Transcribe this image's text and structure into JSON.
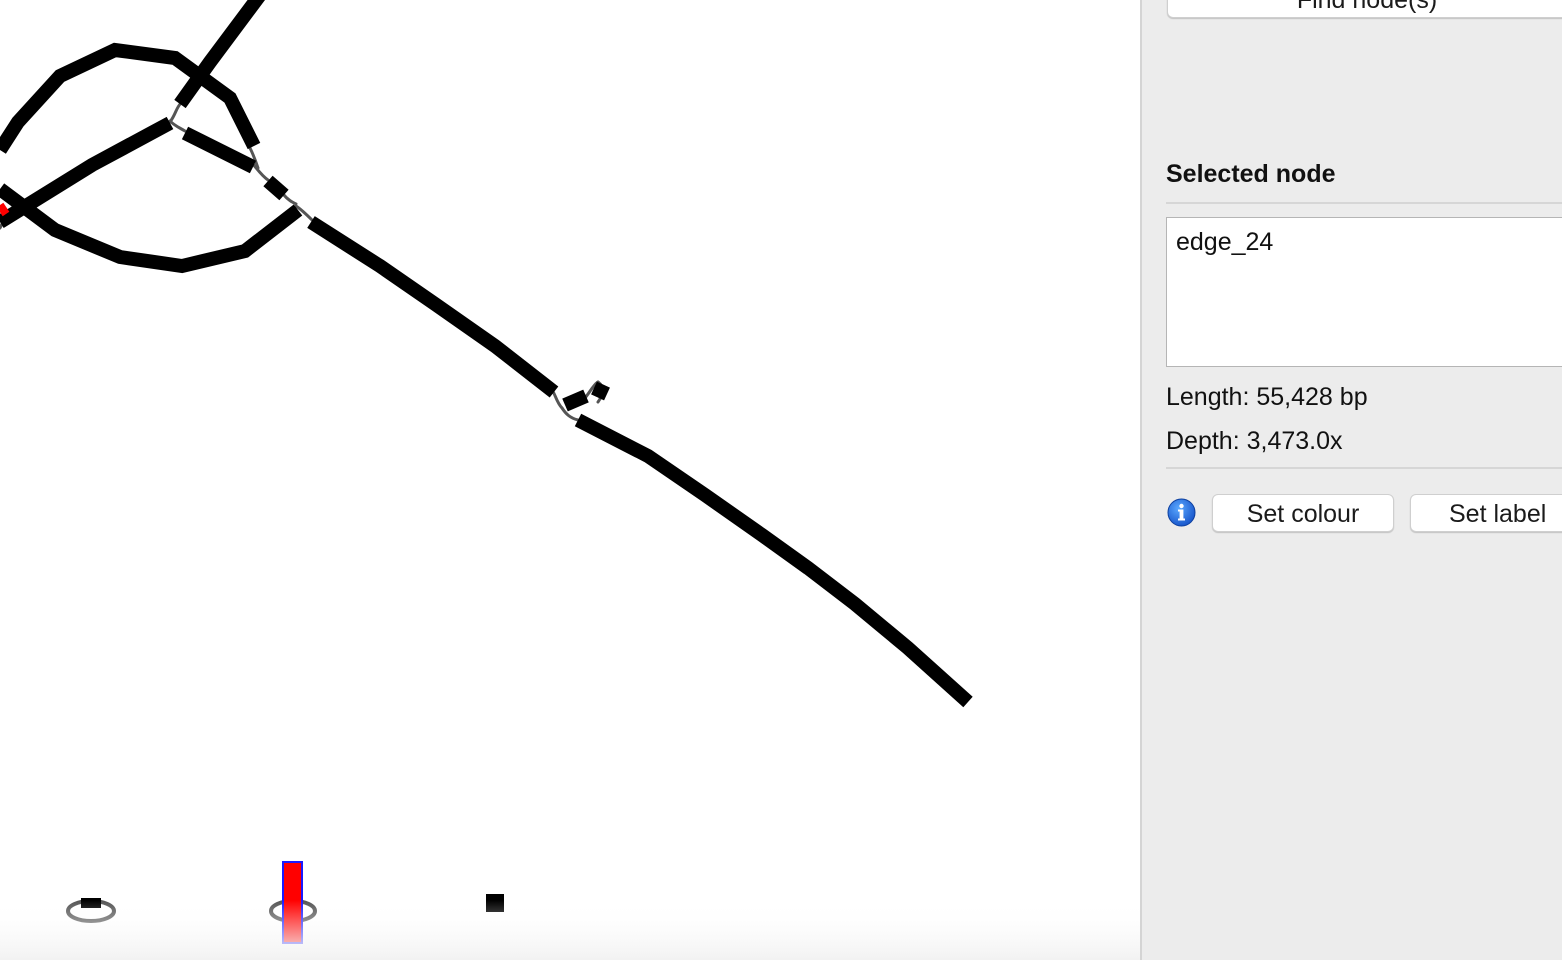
{
  "graph": {
    "edge_color": "#000000",
    "link_color": "#555555",
    "highlight_color": "#ff0000",
    "legend_highlight_border": "#1a1aff"
  },
  "side_panel": {
    "find_button_label": "Find node(s)",
    "selected_heading": "Selected node",
    "selected_node_text": "edge_24",
    "length_label": "Length:",
    "length_value": "55,428 bp",
    "depth_label": "Depth:",
    "depth_value": "3,473.0x",
    "info_icon": "info-icon",
    "set_colour_label": "Set colour",
    "set_label_label": "Set label"
  }
}
